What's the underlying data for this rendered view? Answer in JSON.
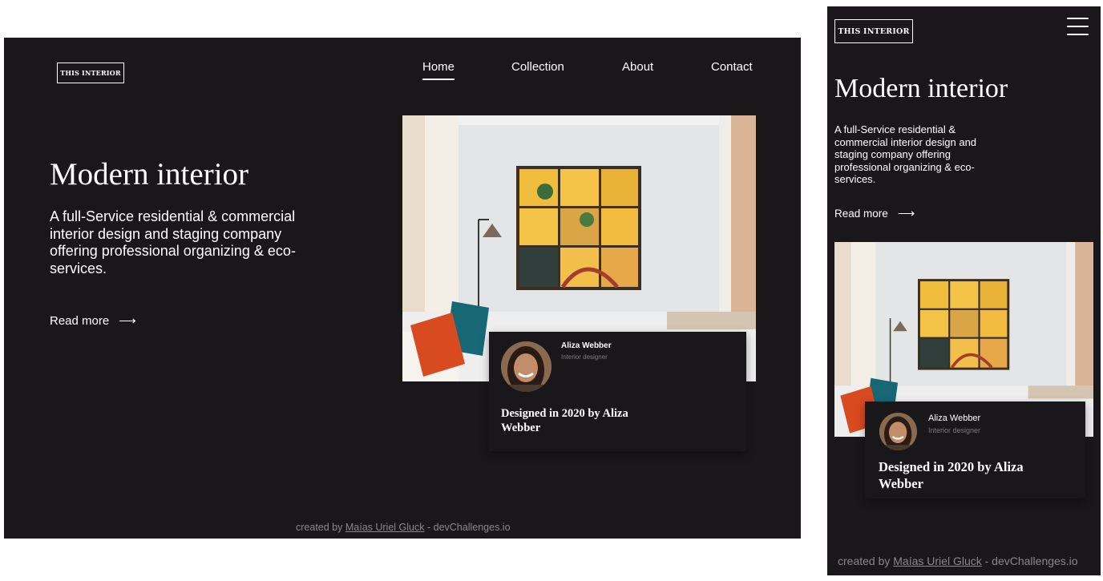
{
  "brand": {
    "logo_text": "This Interior"
  },
  "nav": {
    "home": "Home",
    "collection": "Collection",
    "about": "About",
    "contact": "Contact"
  },
  "hero": {
    "title": "Modern interior",
    "description": "A full-Service residential & commercial interior design and staging company offering professional organizing & eco-services.",
    "read_more": "Read more",
    "arrow": "⟶"
  },
  "card": {
    "author_name": "Aliza Webber",
    "author_role": "Interior designer",
    "caption": "Designed in 2020 by Aliza Webber"
  },
  "footer": {
    "prefix": "created by",
    "author": "Maías Uriel Gluck",
    "suffix": "- devChallenges.io"
  },
  "icons": {
    "menu": "hamburger-menu-icon",
    "arrow": "arrow-right-icon"
  },
  "colors": {
    "background": "#19171a",
    "text": "#ffffff",
    "muted": "#8a878c"
  }
}
